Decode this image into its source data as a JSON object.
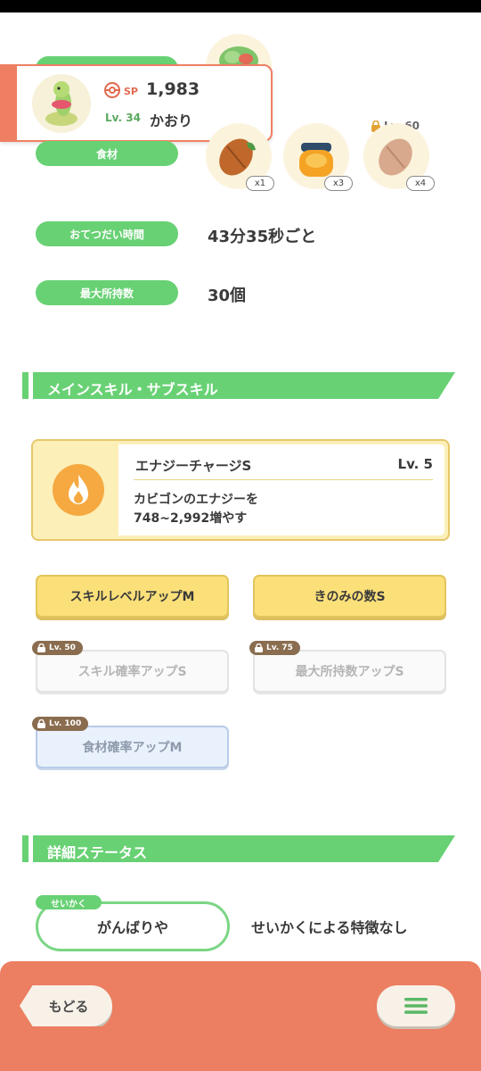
{
  "pokemon": {
    "sp_label": "SP",
    "sp_value": "1,983",
    "level": "Lv. 34",
    "name": "かおり"
  },
  "ingredients": {
    "label": "食材",
    "items": [
      {
        "icon": "cocoa-icon",
        "qty": "x1"
      },
      {
        "icon": "honey-icon",
        "qty": "x3"
      },
      {
        "icon": "cocoa-locked-icon",
        "qty": "x4",
        "unlock_level": "Lv. 60"
      }
    ]
  },
  "stats": {
    "help_time_label": "おてつだい時間",
    "help_time_value": "43分35秒ごと",
    "max_carry_label": "最大所持数",
    "max_carry_value": "30個"
  },
  "skills_section": {
    "title": "メインスキル・サブスキル"
  },
  "main_skill": {
    "name": "エナジーチャージS",
    "level": "Lv. 5",
    "desc_line1": "カビゴンのエナジーを",
    "desc_line2": "748~2,992増やす",
    "icon": "flame-icon"
  },
  "subskills": [
    {
      "label": "スキルレベルアップM",
      "state": "unlocked"
    },
    {
      "label": "きのみの数S",
      "state": "unlocked"
    },
    {
      "label": "スキル確率アップS",
      "state": "locked",
      "unlock": "Lv. 50"
    },
    {
      "label": "最大所持数アップS",
      "state": "locked",
      "unlock": "Lv. 75"
    },
    {
      "label": "食材確率アップM",
      "state": "locked",
      "unlock": "Lv. 100"
    }
  ],
  "details_section": {
    "title": "詳細ステータス"
  },
  "nature": {
    "tag": "せいかく",
    "value": "がんばりや",
    "description": "せいかくによる特徴なし"
  },
  "bottom": {
    "back_label": "もどる",
    "menu_icon": "hamburger-menu-icon"
  },
  "colors": {
    "green": "#68d174",
    "coral": "#ec7e61",
    "gold": "#fbe07a",
    "skill_orange": "#f5a940"
  }
}
